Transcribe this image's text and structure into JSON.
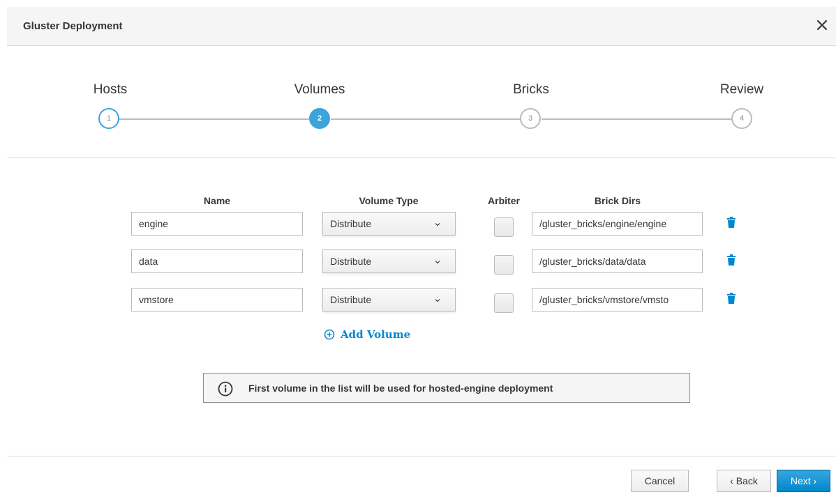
{
  "dialog": {
    "title": "Gluster Deployment",
    "close_icon": "close-icon"
  },
  "wizard": {
    "steps": [
      {
        "label": "Hosts",
        "number": "1",
        "state": "done"
      },
      {
        "label": "Volumes",
        "number": "2",
        "state": "active"
      },
      {
        "label": "Bricks",
        "number": "3",
        "state": "todo"
      },
      {
        "label": "Review",
        "number": "4",
        "state": "todo"
      }
    ]
  },
  "table": {
    "headers": {
      "name": "Name",
      "volume_type": "Volume Type",
      "arbiter": "Arbiter",
      "brick_dirs": "Brick Dirs"
    },
    "rows": [
      {
        "name": "engine",
        "volume_type": "Distribute",
        "arbiter": false,
        "brick_dir": "/gluster_bricks/engine/engine"
      },
      {
        "name": "data",
        "volume_type": "Distribute",
        "arbiter": false,
        "brick_dir": "/gluster_bricks/data/data"
      },
      {
        "name": "vmstore",
        "volume_type": "Distribute",
        "arbiter": false,
        "brick_dir": "/gluster_bricks/vmstore/vmsto"
      }
    ],
    "add_volume_label": "Add Volume"
  },
  "info": {
    "message": "First volume in the list will be used for hosted-engine deployment"
  },
  "footer": {
    "cancel_label": "Cancel",
    "back_label": "‹ Back",
    "next_label": "Next ›"
  },
  "colors": {
    "accent": "#39a5dc",
    "primary": "#0088ce",
    "inactive": "#bbbbbb"
  }
}
